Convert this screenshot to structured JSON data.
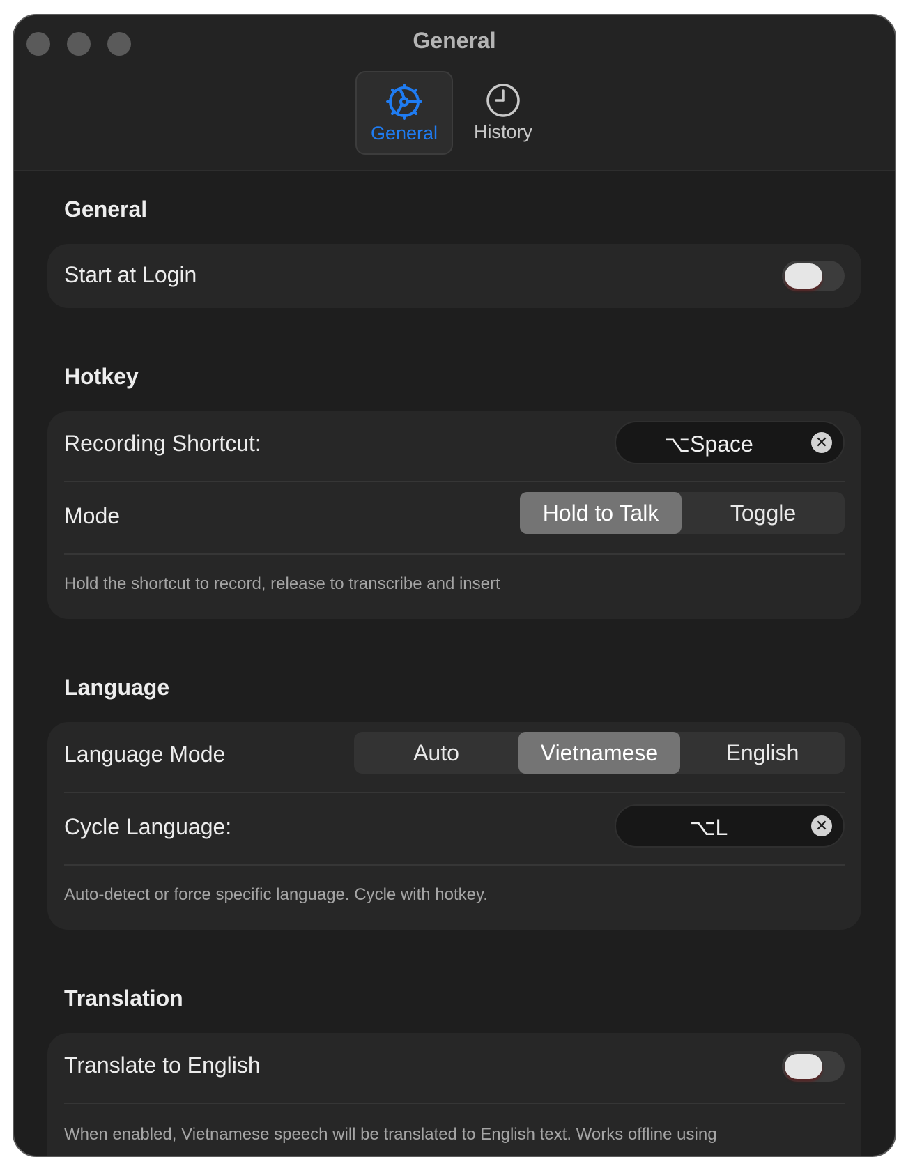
{
  "window": {
    "title": "General"
  },
  "tabs": [
    {
      "label": "General",
      "icon": "gear-icon",
      "selected": true
    },
    {
      "label": "History",
      "icon": "clock-icon",
      "selected": false
    }
  ],
  "colors": {
    "accent": "#1f7cf2",
    "background": "#1e1e1e",
    "card": "#272727"
  },
  "sections": {
    "general": {
      "title": "General",
      "start_at_login": {
        "label": "Start at Login",
        "on": false
      }
    },
    "hotkey": {
      "title": "Hotkey",
      "recording_shortcut": {
        "label": "Recording Shortcut:",
        "value": "⌥Space"
      },
      "mode": {
        "label": "Mode",
        "options": [
          "Hold to Talk",
          "Toggle"
        ],
        "selected": "Hold to Talk"
      },
      "hint": "Hold the shortcut to record, release to transcribe and insert"
    },
    "language": {
      "title": "Language",
      "language_mode": {
        "label": "Language Mode",
        "options": [
          "Auto",
          "Vietnamese",
          "English"
        ],
        "selected": "Vietnamese"
      },
      "cycle_language": {
        "label": "Cycle Language:",
        "value": "⌥L"
      },
      "hint": "Auto-detect or force specific language. Cycle with hotkey."
    },
    "translation": {
      "title": "Translation",
      "translate_to_english": {
        "label": "Translate to English",
        "on": false
      },
      "hint": "When enabled, Vietnamese speech will be translated to English text. Works offline using"
    }
  }
}
